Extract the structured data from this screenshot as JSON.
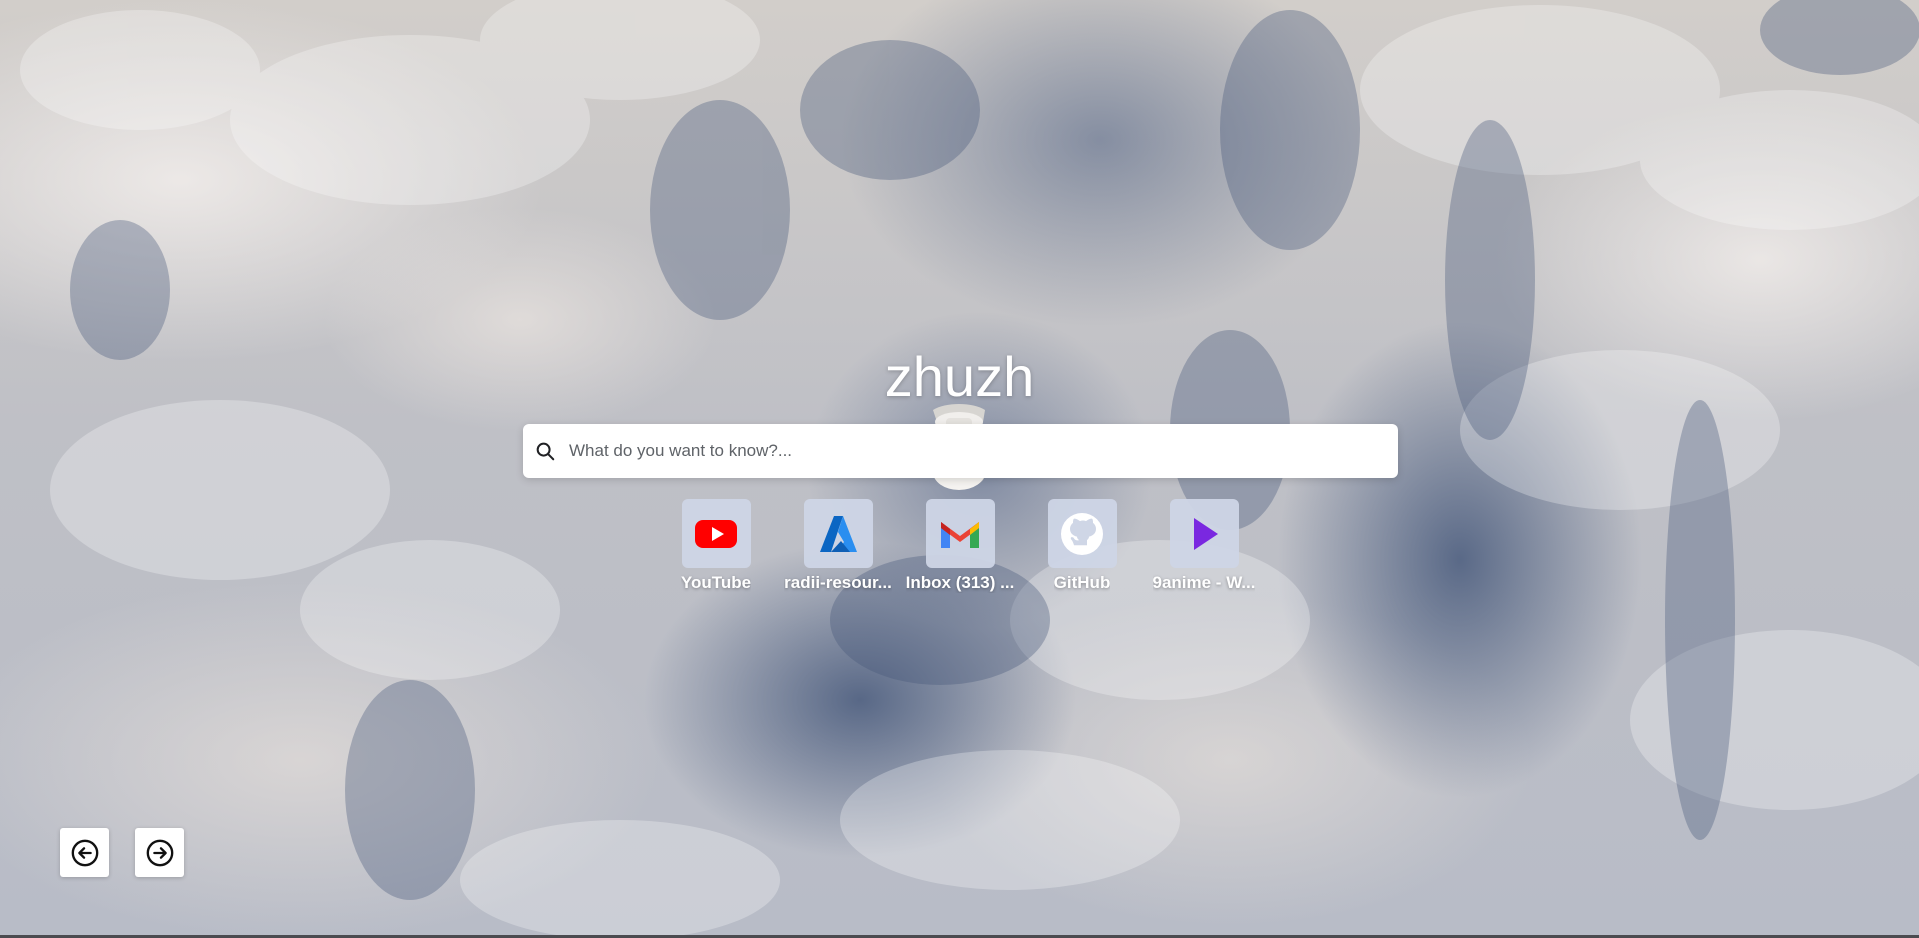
{
  "page": {
    "title": "zhuzh"
  },
  "search": {
    "placeholder": "What do you want to know?..."
  },
  "shortcuts": [
    {
      "label": "YouTube",
      "icon": "youtube-icon",
      "color": "#ff0000"
    },
    {
      "label": "radii-resour...",
      "icon": "azure-icon",
      "color": "#0078d4"
    },
    {
      "label": "Inbox (313) ...",
      "icon": "gmail-icon",
      "color": "#ea4335"
    },
    {
      "label": "GitHub",
      "icon": "github-icon",
      "color": "#ffffff"
    },
    {
      "label": "9anime - W...",
      "icon": "play-icon",
      "color": "#7a28e0"
    }
  ],
  "navigation": {
    "previous_icon": "arrow-left-circle-icon",
    "next_icon": "arrow-right-circle-icon"
  },
  "background": {
    "icon": "cloud-background"
  }
}
